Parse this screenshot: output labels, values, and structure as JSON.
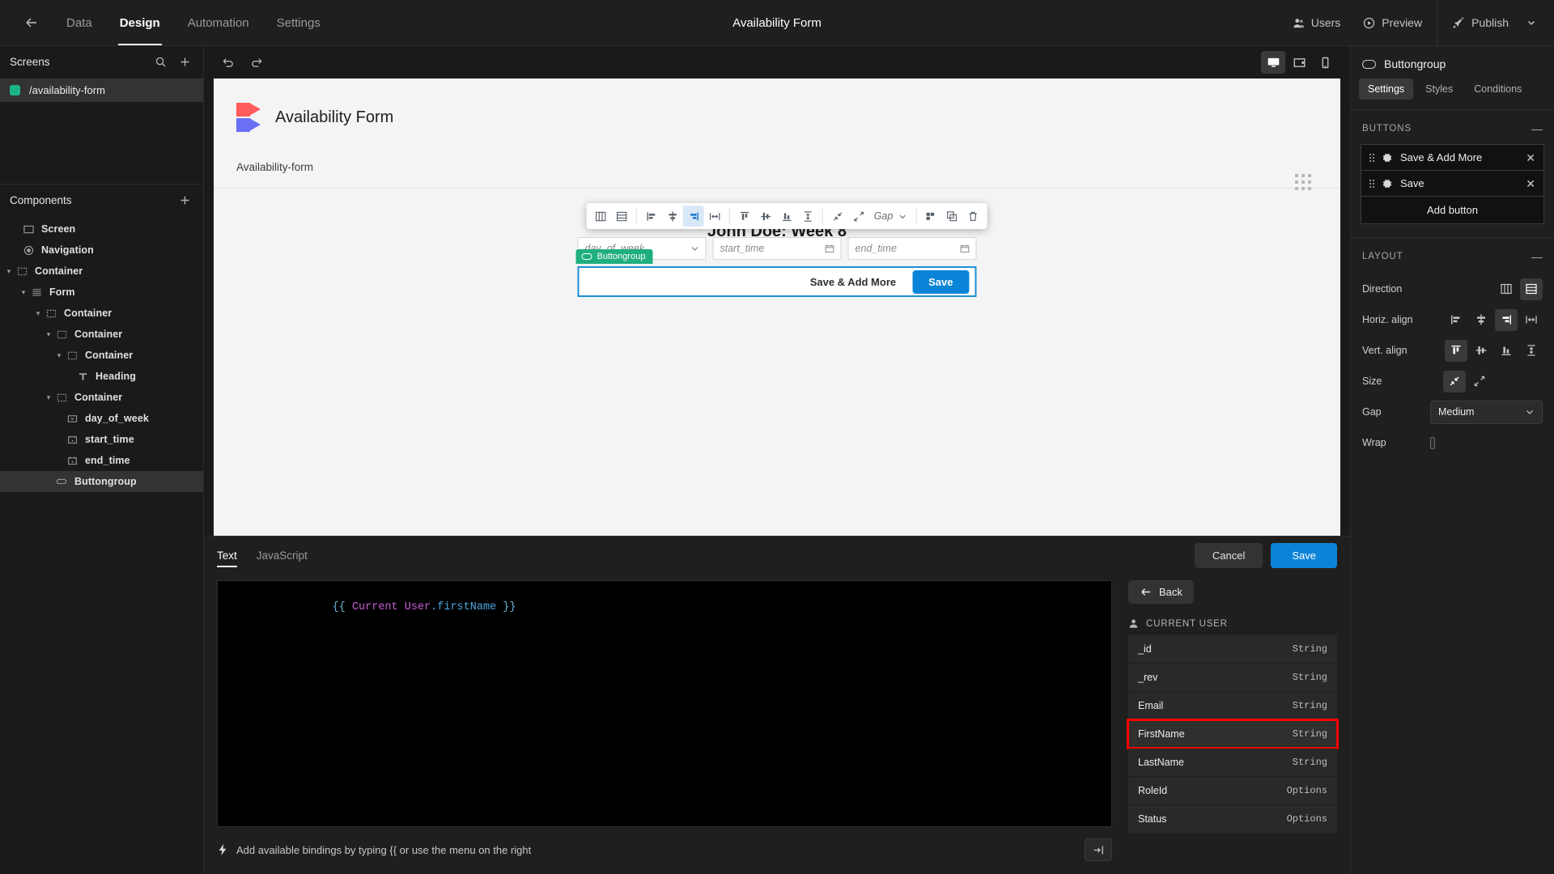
{
  "topbar": {
    "back_icon": "arrow-left-icon",
    "tabs": [
      {
        "label": "Data",
        "active": false
      },
      {
        "label": "Design",
        "active": true
      },
      {
        "label": "Automation",
        "active": false
      },
      {
        "label": "Settings",
        "active": false
      }
    ],
    "title": "Availability Form",
    "users_label": "Users",
    "preview_label": "Preview",
    "publish_label": "Publish"
  },
  "left_panel": {
    "screens_title": "Screens",
    "search_icon": "search-icon",
    "add_icon": "plus-icon",
    "screens": [
      {
        "name": "/availability-form",
        "color": "#1cb489",
        "selected": true
      }
    ],
    "components_title": "Components",
    "components_add_icon": "plus-icon",
    "components": [
      {
        "label": "Screen",
        "icon": "screen-icon",
        "depth": 0,
        "caret": "",
        "selected": false
      },
      {
        "label": "Navigation",
        "icon": "navigation-icon",
        "depth": 0,
        "caret": "",
        "selected": false
      },
      {
        "label": "Container",
        "icon": "container-icon",
        "depth": 0,
        "caret": "v",
        "selected": false
      },
      {
        "label": "Form",
        "icon": "form-icon",
        "depth": 1,
        "caret": "v",
        "selected": false
      },
      {
        "label": "Container",
        "icon": "container-icon",
        "depth": 2,
        "caret": "v",
        "selected": false
      },
      {
        "label": "Container",
        "icon": "container-icon",
        "depth": 3,
        "caret": "v",
        "selected": false
      },
      {
        "label": "Container",
        "icon": "container-icon",
        "depth": 4,
        "caret": "v",
        "selected": false
      },
      {
        "label": "Heading",
        "icon": "heading-icon",
        "depth": 5,
        "caret": "",
        "selected": false
      },
      {
        "label": "Container",
        "icon": "container-icon",
        "depth": 3,
        "caret": "v",
        "selected": false
      },
      {
        "label": "day_of_week",
        "icon": "select-icon",
        "depth": 4,
        "caret": "",
        "selected": false
      },
      {
        "label": "start_time",
        "icon": "date-icon",
        "depth": 4,
        "caret": "",
        "selected": false
      },
      {
        "label": "end_time",
        "icon": "date-icon",
        "depth": 4,
        "caret": "",
        "selected": false
      },
      {
        "label": "Buttongroup",
        "icon": "buttongroup-icon",
        "depth": 3,
        "caret": "",
        "selected": true
      }
    ]
  },
  "center": {
    "undo_icon": "undo-icon",
    "redo_icon": "redo-icon",
    "devices": [
      {
        "name": "desktop-view",
        "active": true
      },
      {
        "name": "tablet-view",
        "active": false
      },
      {
        "name": "mobile-view",
        "active": false
      }
    ],
    "preview": {
      "app_name": "Availability Form",
      "breadcrumb": "Availability-form",
      "heading": "John Doe: Week 8",
      "grip_icon": "drag-handle-icon",
      "fields": [
        {
          "placeholder": "day_of_week",
          "icon": "chevron-down-icon"
        },
        {
          "placeholder": "start_time",
          "icon": "calendar-icon"
        },
        {
          "placeholder": "end_time",
          "icon": "calendar-icon"
        }
      ],
      "selection_tag": "Buttongroup",
      "buttons": [
        {
          "label": "Save & Add More",
          "style": "secondary"
        },
        {
          "label": "Save",
          "style": "primary"
        }
      ]
    },
    "toolbar": {
      "gap_label": "Gap",
      "items": [
        {
          "name": "direction-horizontal-button",
          "active": false
        },
        {
          "name": "direction-vertical-button",
          "active": false
        },
        {
          "name": "align-left-button",
          "active": false
        },
        {
          "name": "align-center-button",
          "active": false
        },
        {
          "name": "align-right-button",
          "active": true
        },
        {
          "name": "align-stretch-horizontal-button",
          "active": false
        },
        {
          "name": "align-top-button",
          "active": false
        },
        {
          "name": "align-middle-button",
          "active": false
        },
        {
          "name": "align-bottom-button",
          "active": false
        },
        {
          "name": "align-stretch-vertical-button",
          "active": false
        },
        {
          "name": "shrink-button",
          "active": false
        },
        {
          "name": "grow-button",
          "active": false
        },
        {
          "name": "wrap-button",
          "active": false
        },
        {
          "name": "duplicate-button",
          "active": false
        },
        {
          "name": "delete-button",
          "active": false
        }
      ]
    }
  },
  "drawer": {
    "tabs": [
      {
        "label": "Text",
        "active": true
      },
      {
        "label": "JavaScript",
        "active": false
      }
    ],
    "cancel_label": "Cancel",
    "save_label": "Save",
    "code": {
      "open": "{{ ",
      "ident": "Current User",
      "prop": ".firstName",
      "close": " }}"
    },
    "hint": "Add available bindings by typing {{ or use the menu on the right",
    "hint_icon": "lightning-icon",
    "expand_icon": "expand-editor-icon",
    "back_label": "Back",
    "binding_section": "CURRENT USER",
    "binding_section_icon": "user-icon",
    "bindings": [
      {
        "name": "_id",
        "type": "String",
        "highlight": false
      },
      {
        "name": "_rev",
        "type": "String",
        "highlight": false
      },
      {
        "name": "Email",
        "type": "String",
        "highlight": false
      },
      {
        "name": "FirstName",
        "type": "String",
        "highlight": true
      },
      {
        "name": "LastName",
        "type": "String",
        "highlight": false
      },
      {
        "name": "RoleId",
        "type": "Options",
        "highlight": false
      },
      {
        "name": "Status",
        "type": "Options",
        "highlight": false
      }
    ]
  },
  "right_panel": {
    "component_name": "Buttongroup",
    "component_icon": "buttongroup-icon",
    "tabs": [
      {
        "label": "Settings",
        "active": true
      },
      {
        "label": "Styles",
        "active": false
      },
      {
        "label": "Conditions",
        "active": false
      }
    ],
    "buttons_section": {
      "title": "BUTTONS",
      "collapse_icon": "minus-icon",
      "items": [
        {
          "label": "Save & Add More",
          "gear_icon": "gear-icon",
          "close_icon": "close-icon"
        },
        {
          "label": "Save",
          "gear_icon": "gear-icon",
          "close_icon": "close-icon"
        }
      ],
      "add_label": "Add button"
    },
    "layout_section": {
      "title": "LAYOUT",
      "collapse_icon": "minus-icon",
      "direction_label": "Direction",
      "direction_options": [
        {
          "name": "direction-columns-option",
          "active": false
        },
        {
          "name": "direction-rows-option",
          "active": true
        }
      ],
      "horiz_label": "Horiz. align",
      "horiz_options": [
        {
          "name": "halign-left-option",
          "active": false
        },
        {
          "name": "halign-center-option",
          "active": false
        },
        {
          "name": "halign-right-option",
          "active": true
        },
        {
          "name": "halign-stretch-option",
          "active": false
        }
      ],
      "vert_label": "Vert. align",
      "vert_options": [
        {
          "name": "valign-top-option",
          "active": true
        },
        {
          "name": "valign-middle-option",
          "active": false
        },
        {
          "name": "valign-bottom-option",
          "active": false
        },
        {
          "name": "valign-stretch-option",
          "active": false
        }
      ],
      "size_label": "Size",
      "size_options": [
        {
          "name": "size-shrink-option",
          "active": true
        },
        {
          "name": "size-grow-option",
          "active": false
        }
      ],
      "gap_label": "Gap",
      "gap_value": "Medium",
      "wrap_label": "Wrap",
      "wrap_checked": false
    }
  }
}
